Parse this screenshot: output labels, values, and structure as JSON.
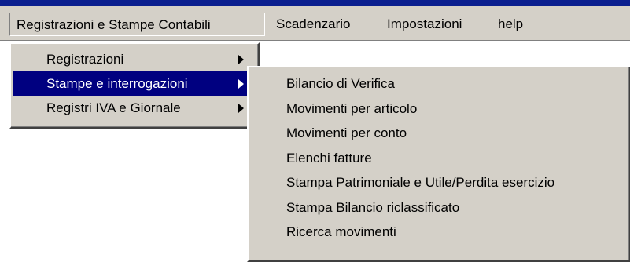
{
  "menubar": {
    "items": [
      {
        "label": "Registrazioni e Stampe Contabili"
      },
      {
        "label": "Scadenzario"
      },
      {
        "label": "Impostazioni"
      },
      {
        "label": "help"
      }
    ]
  },
  "main_menu": {
    "items": [
      {
        "label": "Registrazioni"
      },
      {
        "label": "Stampe e interrogazioni"
      },
      {
        "label": "Registri IVA e Giornale"
      }
    ]
  },
  "submenu": {
    "items": [
      {
        "label": "Bilancio di Verifica"
      },
      {
        "label": "Movimenti per articolo"
      },
      {
        "label": "Movimenti per conto"
      },
      {
        "label": "Elenchi fatture"
      },
      {
        "label": "Stampa Patrimoniale e Utile/Perdita esercizio"
      },
      {
        "label": "Stampa Bilancio riclassificato"
      },
      {
        "label": "Ricerca movimenti"
      }
    ]
  },
  "colors": {
    "menu_background": "#d4d0c8",
    "highlight": "#000080",
    "title_bar_strip": "#0a1f8f"
  }
}
